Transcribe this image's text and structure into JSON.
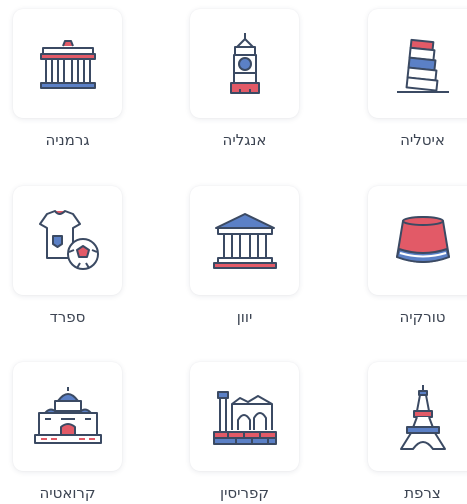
{
  "countries": [
    {
      "label": "גרמניה",
      "icon": "brandenburg-gate-icon"
    },
    {
      "label": "אנגליה",
      "icon": "big-ben-icon"
    },
    {
      "label": "איטליה",
      "icon": "leaning-tower-icon"
    },
    {
      "label": "ספרד",
      "icon": "football-jersey-icon"
    },
    {
      "label": "יוון",
      "icon": "greek-temple-icon"
    },
    {
      "label": "טורקיה",
      "icon": "fez-hat-icon"
    },
    {
      "label": "קרואטיה",
      "icon": "cathedral-icon"
    },
    {
      "label": "קפריסין",
      "icon": "ancient-ruins-icon"
    },
    {
      "label": "צרפת",
      "icon": "eiffel-tower-icon"
    }
  ],
  "colors": {
    "outline": "#3b4a63",
    "accent_red": "#e25a67",
    "accent_blue": "#5b80c6",
    "pale_blue": "#dfe6f5",
    "label_text": "#3c4452"
  }
}
